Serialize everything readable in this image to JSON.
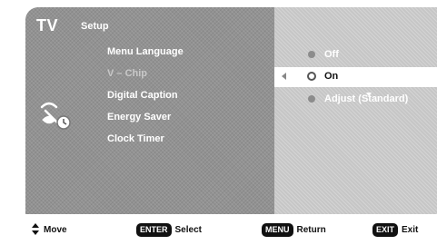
{
  "header": {
    "title": "TV",
    "subtitle": "Setup"
  },
  "menu": {
    "items": [
      {
        "label": "Menu Language"
      },
      {
        "label": "V – Chip"
      },
      {
        "label": "Digital Caption"
      },
      {
        "label": "Energy Saver"
      },
      {
        "label": "Clock Timer"
      }
    ],
    "active_item": "V – Chip"
  },
  "options": {
    "items": [
      {
        "label": "Off"
      },
      {
        "label": "On"
      },
      {
        "label": "Adjust (Standard)"
      }
    ],
    "selected": "On"
  },
  "footer": {
    "move_label": "Move",
    "enter_key": "ENTER",
    "select_label": "Select",
    "menu_key": "MENU",
    "return_label": "Return",
    "exit_key": "EXIT",
    "exit_label": "Exit"
  },
  "colors": {
    "panel": "#929292",
    "options_panel": "#c6c6c6",
    "highlight": "#ffffff"
  }
}
